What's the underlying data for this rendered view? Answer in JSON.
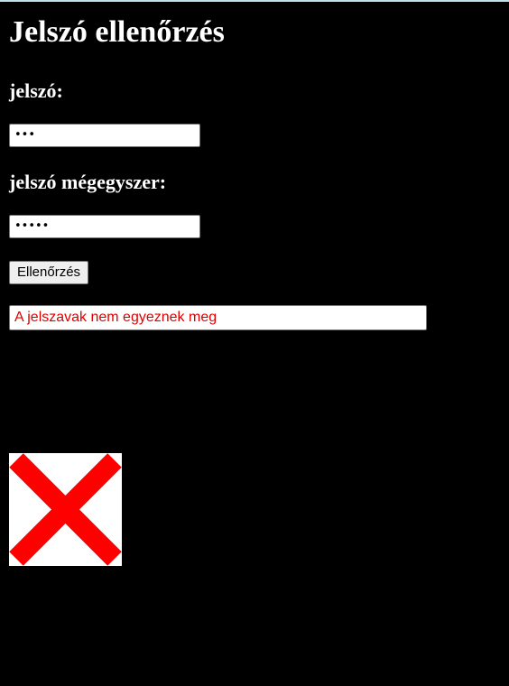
{
  "page": {
    "title": "Jelszó ellenőrzés"
  },
  "form": {
    "password_label": "jelszó:",
    "password_value": "•••",
    "confirm_label": "jelszó mégegyszer:",
    "confirm_value": "•••••",
    "check_button_label": "Ellenőrzés"
  },
  "result": {
    "message": "A jelszavak nem egyeznek meg",
    "message_color": "#e00000",
    "status_icon": "red-x-icon",
    "status_icon_color": "#ff0000"
  },
  "colors": {
    "background": "#000000",
    "text": "#ffffff"
  }
}
